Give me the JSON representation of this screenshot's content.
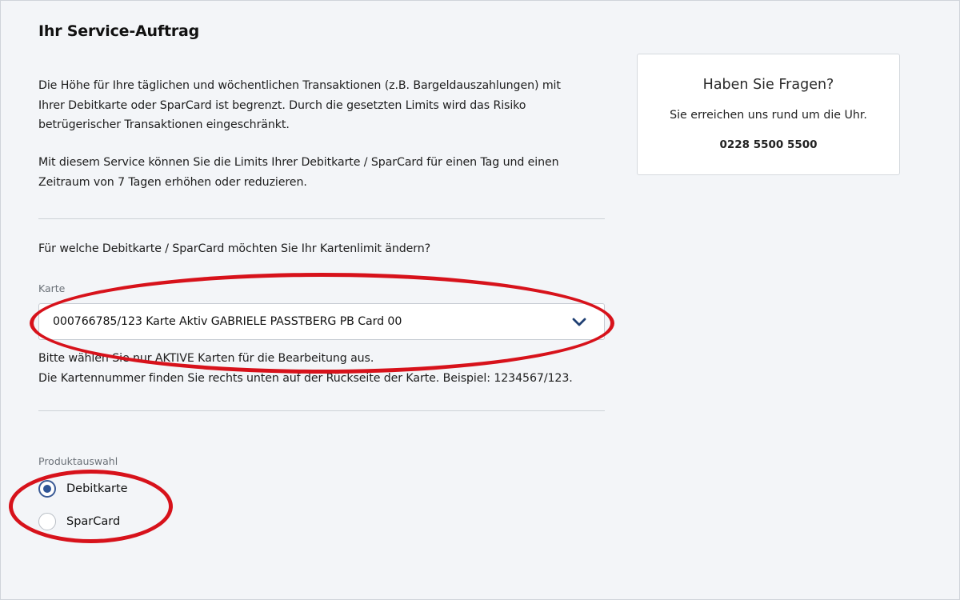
{
  "page": {
    "title": "Ihr Service-Auftrag",
    "intro_lines": [
      "Die Höhe für Ihre täglichen und wöchentlichen Transaktionen (z.B. Bargeldauszahlungen) mit",
      "Ihrer Debitkarte oder SparCard ist begrenzt. Durch die gesetzten Limits wird das Risiko",
      "betrügerischer Transaktionen eingeschränkt."
    ],
    "service_lines": [
      "Mit diesem Service können Sie die Limits Ihrer Debitkarte / SparCard für einen Tag und einen",
      "Zeitraum von 7 Tagen erhöhen oder reduzieren."
    ]
  },
  "card_section": {
    "question": "Für welche Debitkarte / SparCard möchten Sie Ihr Kartenlimit ändern?",
    "field_label": "Karte",
    "selected_value": "000766785/123 Karte Aktiv GABRIELE PASSTBERG PB Card 00",
    "chevron_icon": "chevron-down-icon",
    "hint_lines": [
      "Bitte wählen Sie nur AKTIVE Karten für die Bearbeitung aus.",
      "Die Kartennummer finden Sie rechts unten auf der Rückseite der Karte. Beispiel: 1234567/123."
    ]
  },
  "product_section": {
    "field_label": "Produktauswahl",
    "options": [
      {
        "label": "Debitkarte",
        "selected": true
      },
      {
        "label": "SparCard",
        "selected": false
      }
    ]
  },
  "info_box": {
    "title": "Haben Sie Fragen?",
    "text": "Sie erreichen uns rund um die Uhr.",
    "phone": "0228 5500 5500"
  },
  "colors": {
    "page_background": "#f3f5f8",
    "accent_blue": "#2f5496",
    "chevron": "#1f3f73",
    "annotation_red": "#d7121b"
  }
}
